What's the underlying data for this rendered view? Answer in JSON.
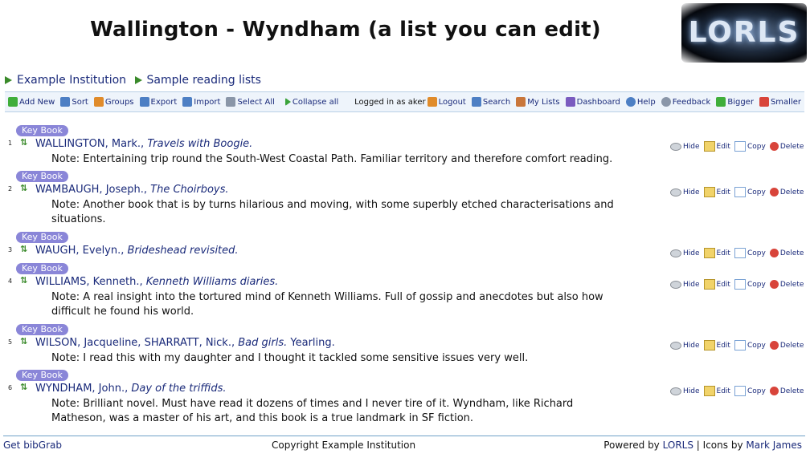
{
  "page_title": "Wallington - Wyndham (a list you can edit)",
  "logo_text": "LORLS",
  "breadcrumb": [
    {
      "label": "Example Institution"
    },
    {
      "label": "Sample reading lists"
    }
  ],
  "toolbar": {
    "left": [
      {
        "label": "Add New",
        "icon": "add-icon"
      },
      {
        "label": "Sort",
        "icon": "sort-icon"
      },
      {
        "label": "Groups",
        "icon": "groups-icon"
      },
      {
        "label": "Export",
        "icon": "export-icon"
      },
      {
        "label": "Import",
        "icon": "import-icon"
      },
      {
        "label": "Select All",
        "icon": "select-all-icon"
      },
      {
        "label": "Collapse all",
        "icon": "collapse-icon"
      }
    ],
    "logged_in": "Logged in as aker",
    "right": [
      {
        "label": "Logout",
        "icon": "logout-icon"
      },
      {
        "label": "Search",
        "icon": "search-icon"
      },
      {
        "label": "My Lists",
        "icon": "home-icon"
      },
      {
        "label": "Dashboard",
        "icon": "dashboard-icon"
      },
      {
        "label": "Help",
        "icon": "help-icon"
      },
      {
        "label": "Feedback",
        "icon": "feedback-icon"
      },
      {
        "label": "Bigger",
        "icon": "zoom-in-icon"
      },
      {
        "label": "Smaller",
        "icon": "zoom-out-icon"
      }
    ]
  },
  "entry_actions": {
    "hide": "Hide",
    "edit": "Edit",
    "copy": "Copy",
    "delete": "Delete"
  },
  "entries": [
    {
      "badge": "Key Book",
      "num": "1",
      "authors": "WALLINGTON, Mark.,",
      "title": "Travels with Boogie.",
      "extra": "",
      "note": "Note: Entertaining trip round the South-West Coastal Path. Familiar territory and therefore comfort reading."
    },
    {
      "badge": "Key Book",
      "num": "2",
      "authors": "WAMBAUGH, Joseph.,",
      "title": "The Choirboys.",
      "extra": "",
      "note": "Note: Another book that is by turns hilarious and moving, with some superbly etched characterisations and situations."
    },
    {
      "badge": "Key Book",
      "num": "3",
      "authors": "WAUGH, Evelyn.,",
      "title": "Brideshead revisited.",
      "extra": "",
      "note": ""
    },
    {
      "badge": "Key Book",
      "num": "4",
      "authors": "WILLIAMS, Kenneth.,",
      "title": "Kenneth Williams diaries.",
      "extra": "",
      "note": "Note: A real insight into the tortured mind of Kenneth Williams. Full of gossip and anecdotes but also how difficult he found his world."
    },
    {
      "badge": "Key Book",
      "num": "5",
      "authors": "WILSON, Jacqueline, SHARRATT, Nick.,",
      "title": "Bad girls.",
      "extra": "Yearling.",
      "note": "Note: I read this with my daughter and I thought it tackled some sensitive issues very well."
    },
    {
      "badge": "Key Book",
      "num": "6",
      "authors": "WYNDHAM, John.,",
      "title": "Day of the triffids.",
      "extra": "",
      "note": "Note: Brilliant novel. Must have read it dozens of times and I never tire of it. Wyndham, like Richard Matheson, was a master of his art, and this book is a true landmark in SF fiction."
    }
  ],
  "footer": {
    "left": "Get bibGrab",
    "center": "Copyright Example Institution",
    "powered_prefix": "Powered by",
    "powered_link": "LORLS",
    "sep": "|",
    "icons_prefix": "Icons by",
    "icons_link": "Mark James"
  }
}
